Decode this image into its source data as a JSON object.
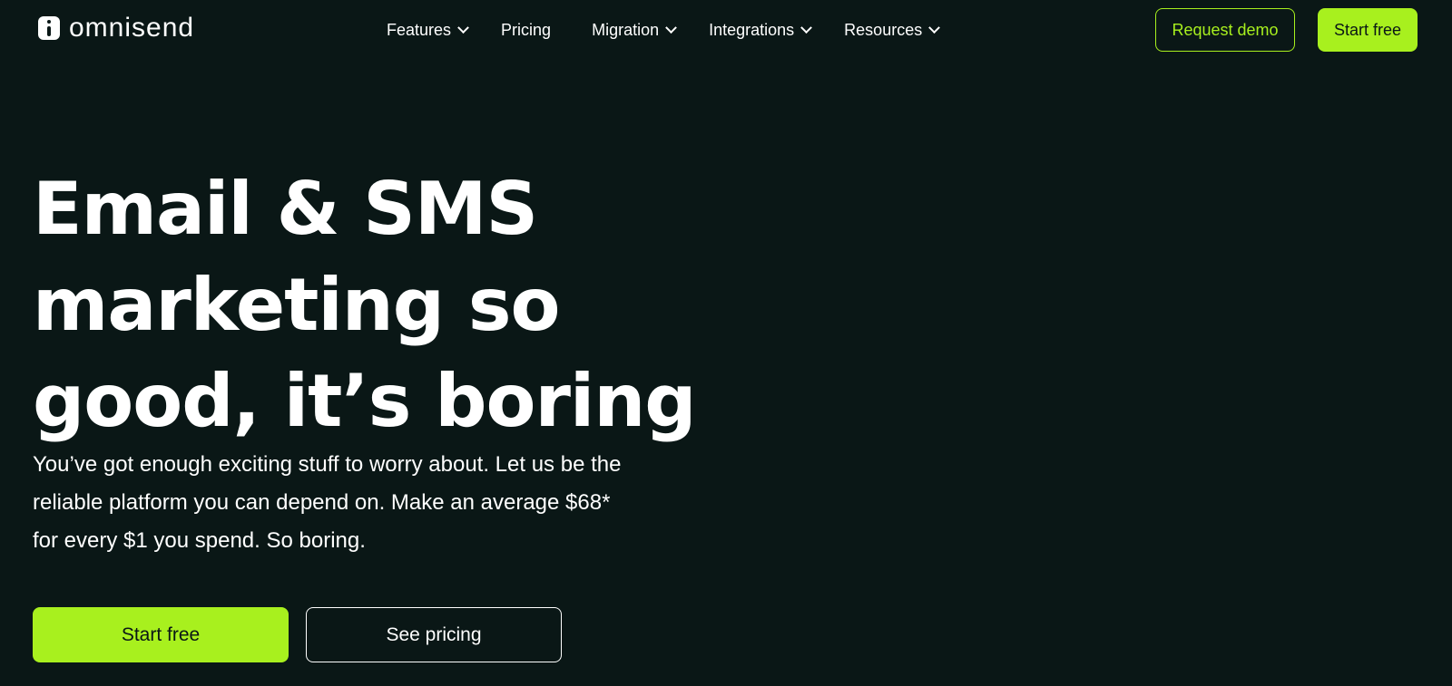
{
  "colors": {
    "background": "#0a1716",
    "accent": "#a8f01e",
    "text": "#ffffff"
  },
  "header": {
    "logo": {
      "icon": "omnisend-logo-icon",
      "text": "omnisend"
    },
    "nav": [
      {
        "label": "Features",
        "has_dropdown": true
      },
      {
        "label": "Pricing",
        "has_dropdown": false
      },
      {
        "label": "Migration",
        "has_dropdown": true
      },
      {
        "label": "Integrations",
        "has_dropdown": true
      },
      {
        "label": "Resources",
        "has_dropdown": true
      }
    ],
    "request_demo_label": "Request demo",
    "start_free_label": "Start free"
  },
  "hero": {
    "title": "Email & SMS marketing so good, it’s boring",
    "subtitle": "You’ve got enough exciting stuff to worry about. Let us be the reliable platform you can depend on. Make an average $68* for every $1 you spend. So boring.",
    "primary_cta": "Start free",
    "secondary_cta": "See pricing"
  }
}
